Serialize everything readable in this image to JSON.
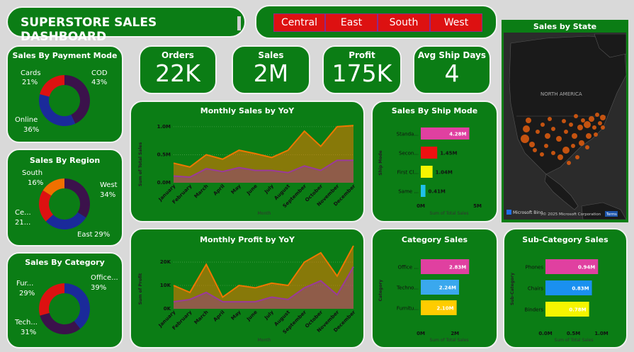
{
  "title": "SUPERSTORE SALES DASHBOARD",
  "regions_slicer": [
    "Central",
    "East",
    "South",
    "West"
  ],
  "kpis": [
    {
      "label": "Orders",
      "value": "22K"
    },
    {
      "label": "Sales",
      "value": "2M"
    },
    {
      "label": "Profit",
      "value": "175K"
    },
    {
      "label": "Avg Ship Days",
      "value": "4"
    }
  ],
  "map": {
    "title": "Sales by State",
    "continent_label": "NORTH AMERICA",
    "copyright": "© 2025 Microsoft Corporation",
    "terms": "Terms",
    "bing_logo": "Microsoft Bing"
  },
  "colors": {
    "card_bg": "#0b7d15",
    "donut_red": "#dd1111",
    "donut_blue": "#1a2a9a",
    "donut_purple": "#3b124b",
    "donut_orange": "#f07000",
    "area_orange": "#ee7700",
    "area_purple": "#9a3a9a",
    "bar_pink": "#e040a0",
    "bar_red": "#ee1111",
    "bar_yellow": "#f5f500",
    "bar_cyan": "#20c0e8",
    "bar_blue": "#3aa8ee",
    "bar_gold": "#ffcc00",
    "bar_brightblue": "#1a90f0"
  },
  "chart_data": [
    {
      "id": "payment",
      "type": "pie",
      "title": "Sales By Payment Mode",
      "slices": [
        {
          "name": "COD",
          "pct": 43,
          "color": "#3b124b"
        },
        {
          "name": "Online",
          "pct": 36,
          "color": "#1a2a9a"
        },
        {
          "name": "Cards",
          "pct": 21,
          "color": "#dd1111"
        }
      ],
      "labels": [
        {
          "name": "Cards",
          "pct": "21%"
        },
        {
          "name": "COD",
          "pct": "43%"
        },
        {
          "name": "Online",
          "pct": "36%"
        }
      ]
    },
    {
      "id": "region",
      "type": "pie",
      "title": "Sales By Region",
      "slices": [
        {
          "name": "West",
          "pct": 34,
          "color": "#3b124b"
        },
        {
          "name": "East",
          "pct": 29,
          "color": "#1a2a9a"
        },
        {
          "name": "Central",
          "pct": 21,
          "color": "#dd1111"
        },
        {
          "name": "South",
          "pct": 16,
          "color": "#f07000"
        }
      ],
      "labels": [
        {
          "name": "South",
          "pct": "16%"
        },
        {
          "name": "West",
          "pct": "34%"
        },
        {
          "name": "Ce...",
          "pct": "21..."
        },
        {
          "name": "East",
          "pct": "29%"
        }
      ]
    },
    {
      "id": "category_pie",
      "type": "pie",
      "title": "Sales By Category",
      "slices": [
        {
          "name": "Office Supplies",
          "pct": 39,
          "color": "#1a2a9a"
        },
        {
          "name": "Technology",
          "pct": 31,
          "color": "#3b124b"
        },
        {
          "name": "Furniture",
          "pct": 29,
          "color": "#dd1111"
        }
      ],
      "labels": [
        {
          "name": "Fur...",
          "pct": "29%"
        },
        {
          "name": "Office...",
          "pct": "39%"
        },
        {
          "name": "Tech...",
          "pct": "31%"
        }
      ]
    },
    {
      "id": "monthly_sales",
      "type": "area",
      "title": "Monthly Sales by YoY",
      "xlabel": "Month",
      "ylabel": "Sum of Total Sales",
      "categories": [
        "January",
        "February",
        "March",
        "April",
        "May",
        "June",
        "July",
        "August",
        "September",
        "October",
        "November",
        "December"
      ],
      "ylim": [
        0,
        1.15
      ],
      "ticks": [
        {
          "v": 0,
          "label": "0.0M"
        },
        {
          "v": 0.5,
          "label": "0.5M"
        },
        {
          "v": 1.0,
          "label": "1.0M"
        }
      ],
      "series": [
        {
          "values": [
            0.35,
            0.28,
            0.5,
            0.42,
            0.58,
            0.52,
            0.45,
            0.58,
            0.92,
            0.65,
            1.0,
            1.02
          ],
          "color": "#ee7700"
        },
        {
          "values": [
            0.12,
            0.1,
            0.25,
            0.2,
            0.27,
            0.22,
            0.22,
            0.18,
            0.3,
            0.22,
            0.4,
            0.4
          ],
          "color": "#9a3a9a"
        }
      ]
    },
    {
      "id": "monthly_profit",
      "type": "area",
      "title": "Monthly Profit by YoY",
      "xlabel": "Month",
      "ylabel": "Sum of Profit",
      "categories": [
        "January",
        "February",
        "March",
        "April",
        "May",
        "June",
        "July",
        "August",
        "September",
        "October",
        "November",
        "December"
      ],
      "ylim": [
        0,
        27000
      ],
      "ticks": [
        {
          "v": 0,
          "label": "0K"
        },
        {
          "v": 10000,
          "label": "10K"
        },
        {
          "v": 20000,
          "label": "20K"
        }
      ],
      "series": [
        {
          "values": [
            10000,
            7000,
            19000,
            5000,
            10000,
            9000,
            11000,
            10000,
            20000,
            24000,
            14000,
            27000
          ],
          "color": "#ee7700"
        },
        {
          "values": [
            3000,
            4000,
            7000,
            3000,
            3000,
            3000,
            5000,
            4000,
            9000,
            12000,
            6000,
            18000
          ],
          "color": "#9a3a9a"
        }
      ]
    },
    {
      "id": "ship_mode",
      "type": "bar",
      "title": "Sales By Ship Mode",
      "xlabel": "Sum of Total Sales",
      "ylabel": "Ship Mode",
      "xmax": 5,
      "xticks": [
        {
          "v": 0,
          "label": "0M"
        },
        {
          "v": 5,
          "label": "5M"
        }
      ],
      "bars": [
        {
          "label": "Standa...",
          "value": 4.28,
          "text": "4.28M",
          "color": "#e040a0"
        },
        {
          "label": "Secon...",
          "value": 1.45,
          "text": "1.45M",
          "color": "#ee1111"
        },
        {
          "label": "First Cl...",
          "value": 1.04,
          "text": "1.04M",
          "color": "#f5f500"
        },
        {
          "label": "Same ...",
          "value": 0.41,
          "text": "0.41M",
          "color": "#20c0e8"
        }
      ]
    },
    {
      "id": "category_bar",
      "type": "bar",
      "title": "Category Sales",
      "xlabel": "Sum of Total Sales",
      "ylabel": "Category",
      "xmax": 3.4,
      "xticks": [
        {
          "v": 0,
          "label": "0M"
        },
        {
          "v": 2,
          "label": "2M"
        }
      ],
      "bars": [
        {
          "label": "Office ...",
          "value": 2.83,
          "text": "2.83M",
          "color": "#e040a0"
        },
        {
          "label": "Techno...",
          "value": 2.24,
          "text": "2.24M",
          "color": "#3aa8ee"
        },
        {
          "label": "Furnitu...",
          "value": 2.1,
          "text": "2.10M",
          "color": "#ffcc00"
        }
      ]
    },
    {
      "id": "subcategory",
      "type": "bar",
      "title": "Sub-Category Sales",
      "xlabel": "Sum of Total Sales",
      "ylabel": "Sub-Category",
      "xmax": 1.0,
      "xticks": [
        {
          "v": 0,
          "label": "0.0M"
        },
        {
          "v": 0.5,
          "label": "0.5M"
        },
        {
          "v": 1.0,
          "label": "1.0M"
        }
      ],
      "bars": [
        {
          "label": "Phones",
          "value": 0.94,
          "text": "0.94M",
          "color": "#e040a0"
        },
        {
          "label": "Chairs",
          "value": 0.83,
          "text": "0.83M",
          "color": "#1a90f0"
        },
        {
          "label": "Binders",
          "value": 0.78,
          "text": "0.78M",
          "color": "#f5f500"
        }
      ]
    }
  ]
}
